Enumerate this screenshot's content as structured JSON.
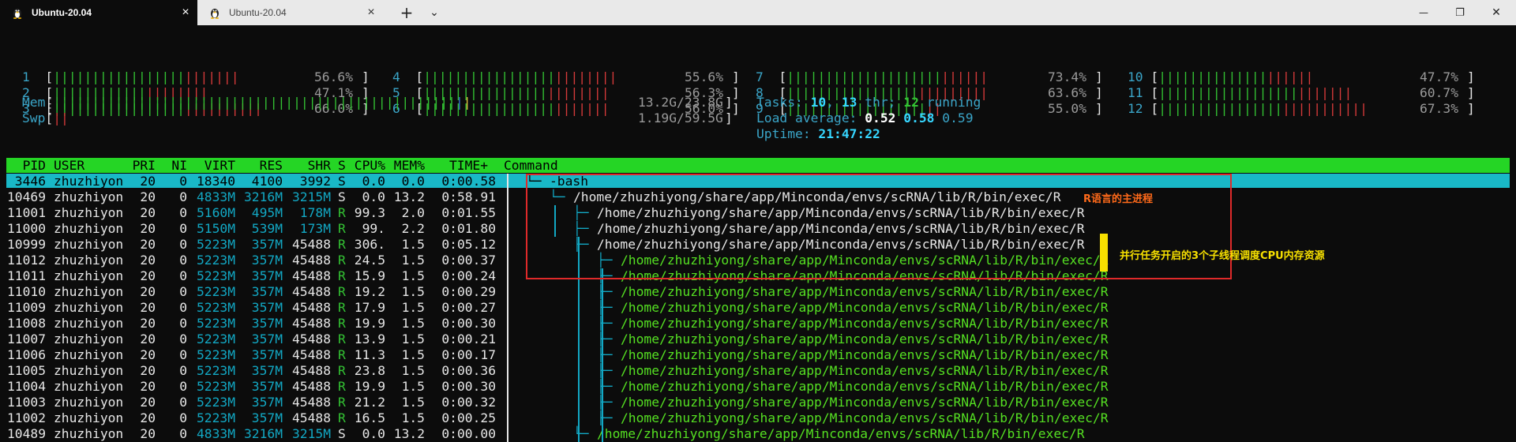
{
  "tabs": [
    {
      "title": "Ubuntu-20.04",
      "active": true
    },
    {
      "title": "Ubuntu-20.04",
      "active": false
    }
  ],
  "controls": {
    "close": "×",
    "new_tab": "+",
    "dropdown": "⌄",
    "min": "—",
    "max": "❐",
    "win_close": "✕"
  },
  "meters": [
    {
      "n": "1",
      "green": "|||||||||||||||||",
      "red": "|||||||",
      "pct": "56.6%"
    },
    {
      "n": "2",
      "green": "||||||||||||",
      "red": "||||||||",
      "pct": "47.1%"
    },
    {
      "n": "3",
      "green": "|||||||||||||||||",
      "red": "||||||||||",
      "pct": "66.0%"
    },
    {
      "n": "4",
      "green": "|||||||||||||||||",
      "red": "||||||||",
      "pct": "55.6%"
    },
    {
      "n": "5",
      "green": "||||||||||||||||",
      "red": "||||||||",
      "pct": "56.3%"
    },
    {
      "n": "6",
      "green": "|||||||||||||||||",
      "red": "|||||||",
      "pct": "56.0%"
    },
    {
      "n": "7",
      "green": "||||||||||||||||||||",
      "red": "||||||",
      "pct": "73.4%"
    },
    {
      "n": "8",
      "green": "|||||||||||||||||",
      "red": "|||||||||",
      "pct": "63.6%"
    },
    {
      "n": "9",
      "green": "||||||||||||||||||",
      "red": "||",
      "pct": "55.0%"
    },
    {
      "n": "10",
      "green": "||||||||||||||",
      "red": "||||||",
      "pct": "47.7%"
    },
    {
      "n": "11",
      "green": "||||||||||||||||||",
      "red": "|||||||",
      "pct": "60.7%"
    },
    {
      "n": "12",
      "green": "||||||||||||||||",
      "red": "|||||||||||",
      "pct": "67.3%"
    }
  ],
  "mem": {
    "label": "Mem",
    "bars": "||||||||||||||||||||||||||||||||||||||||||||||||||||",
    "value": "13.2G/23.8G"
  },
  "swp": {
    "label": "Swp",
    "bars": "||",
    "value": "1.19G/59.5G"
  },
  "tasks": {
    "label": "Tasks: ",
    "count": "10",
    "sep1": ", ",
    "thr": "13",
    "thr_label": " thr; ",
    "running": "12",
    "running_label": " running"
  },
  "load": {
    "label": "Load average: ",
    "v1": "0.52",
    "v2": "0.58",
    "v3": "0.59"
  },
  "uptime": {
    "label": "Uptime: ",
    "value": "21:47:22"
  },
  "columns": [
    "PID",
    "USER",
    "PRI",
    "NI",
    "VIRT",
    "RES",
    "SHR",
    "S",
    "CPU%",
    "MEM%",
    "TIME+",
    "Command"
  ],
  "processes": [
    {
      "pid": "3446",
      "user": "zhuzhiyon",
      "pri": "20",
      "ni": "0",
      "virt": "18340",
      "res": "4100",
      "shr": "3992",
      "s": "S",
      "cpu": "0.0",
      "mem": "0.0",
      "time": "0:00.58",
      "tree": "└─ ",
      "cmd": "-bash",
      "indent": 0,
      "sel": true
    },
    {
      "pid": "10469",
      "user": "zhuzhiyon",
      "pri": "20",
      "ni": "0",
      "virt": "4833M",
      "res": "3216M",
      "shr": "3215M",
      "s": "S",
      "cpu": "0.0",
      "mem": "13.2",
      "time": "0:58.91",
      "tree": "└─ ",
      "cmd": "/home/zhuzhiyong/share/app/Minconda/envs/scRNA/lib/R/bin/exec/R",
      "indent": 1
    },
    {
      "pid": "11001",
      "user": "zhuzhiyon",
      "pri": "20",
      "ni": "0",
      "virt": "5160M",
      "res": "495M",
      "shr": "178M",
      "s": "R",
      "cpu": "99.3",
      "mem": "2.0",
      "time": "0:01.55",
      "tree": "├─ ",
      "cmd": "/home/zhuzhiyong/share/app/Minconda/envs/scRNA/lib/R/bin/exec/R",
      "indent": 2
    },
    {
      "pid": "11000",
      "user": "zhuzhiyon",
      "pri": "20",
      "ni": "0",
      "virt": "5150M",
      "res": "539M",
      "shr": "173M",
      "s": "R",
      "cpu": "99.",
      "mem": "2.2",
      "time": "0:01.80",
      "tree": "├─ ",
      "cmd": "/home/zhuzhiyong/share/app/Minconda/envs/scRNA/lib/R/bin/exec/R",
      "indent": 2
    },
    {
      "pid": "10999",
      "user": "zhuzhiyon",
      "pri": "20",
      "ni": "0",
      "virt": "5223M",
      "res": "357M",
      "shr": "45488",
      "s": "R",
      "cpu": "306.",
      "mem": "1.5",
      "time": "0:05.12",
      "tree": "├─ ",
      "cmd": "/home/zhuzhiyong/share/app/Minconda/envs/scRNA/lib/R/bin/exec/R",
      "indent": 2
    },
    {
      "pid": "11012",
      "user": "zhuzhiyon",
      "pri": "20",
      "ni": "0",
      "virt": "5223M",
      "res": "357M",
      "shr": "45488",
      "s": "R",
      "cpu": "24.5",
      "mem": "1.5",
      "time": "0:00.37",
      "tree": "├─ ",
      "cmd": "/home/zhuzhiyong/share/app/Minconda/envs/scRNA/lib/R/bin/exec/R",
      "indent": 3
    },
    {
      "pid": "11011",
      "user": "zhuzhiyon",
      "pri": "20",
      "ni": "0",
      "virt": "5223M",
      "res": "357M",
      "shr": "45488",
      "s": "R",
      "cpu": "15.9",
      "mem": "1.5",
      "time": "0:00.24",
      "tree": "├─ ",
      "cmd": "/home/zhuzhiyong/share/app/Minconda/envs/scRNA/lib/R/bin/exec/R",
      "indent": 3
    },
    {
      "pid": "11010",
      "user": "zhuzhiyon",
      "pri": "20",
      "ni": "0",
      "virt": "5223M",
      "res": "357M",
      "shr": "45488",
      "s": "R",
      "cpu": "19.2",
      "mem": "1.5",
      "time": "0:00.29",
      "tree": "├─ ",
      "cmd": "/home/zhuzhiyong/share/app/Minconda/envs/scRNA/lib/R/bin/exec/R",
      "indent": 3
    },
    {
      "pid": "11009",
      "user": "zhuzhiyon",
      "pri": "20",
      "ni": "0",
      "virt": "5223M",
      "res": "357M",
      "shr": "45488",
      "s": "R",
      "cpu": "17.9",
      "mem": "1.5",
      "time": "0:00.27",
      "tree": "├─ ",
      "cmd": "/home/zhuzhiyong/share/app/Minconda/envs/scRNA/lib/R/bin/exec/R",
      "indent": 3
    },
    {
      "pid": "11008",
      "user": "zhuzhiyon",
      "pri": "20",
      "ni": "0",
      "virt": "5223M",
      "res": "357M",
      "shr": "45488",
      "s": "R",
      "cpu": "19.9",
      "mem": "1.5",
      "time": "0:00.30",
      "tree": "├─ ",
      "cmd": "/home/zhuzhiyong/share/app/Minconda/envs/scRNA/lib/R/bin/exec/R",
      "indent": 3
    },
    {
      "pid": "11007",
      "user": "zhuzhiyon",
      "pri": "20",
      "ni": "0",
      "virt": "5223M",
      "res": "357M",
      "shr": "45488",
      "s": "R",
      "cpu": "13.9",
      "mem": "1.5",
      "time": "0:00.21",
      "tree": "├─ ",
      "cmd": "/home/zhuzhiyong/share/app/Minconda/envs/scRNA/lib/R/bin/exec/R",
      "indent": 3
    },
    {
      "pid": "11006",
      "user": "zhuzhiyon",
      "pri": "20",
      "ni": "0",
      "virt": "5223M",
      "res": "357M",
      "shr": "45488",
      "s": "R",
      "cpu": "11.3",
      "mem": "1.5",
      "time": "0:00.17",
      "tree": "├─ ",
      "cmd": "/home/zhuzhiyong/share/app/Minconda/envs/scRNA/lib/R/bin/exec/R",
      "indent": 3
    },
    {
      "pid": "11005",
      "user": "zhuzhiyon",
      "pri": "20",
      "ni": "0",
      "virt": "5223M",
      "res": "357M",
      "shr": "45488",
      "s": "R",
      "cpu": "23.8",
      "mem": "1.5",
      "time": "0:00.36",
      "tree": "├─ ",
      "cmd": "/home/zhuzhiyong/share/app/Minconda/envs/scRNA/lib/R/bin/exec/R",
      "indent": 3
    },
    {
      "pid": "11004",
      "user": "zhuzhiyon",
      "pri": "20",
      "ni": "0",
      "virt": "5223M",
      "res": "357M",
      "shr": "45488",
      "s": "R",
      "cpu": "19.9",
      "mem": "1.5",
      "time": "0:00.30",
      "tree": "├─ ",
      "cmd": "/home/zhuzhiyong/share/app/Minconda/envs/scRNA/lib/R/bin/exec/R",
      "indent": 3
    },
    {
      "pid": "11003",
      "user": "zhuzhiyon",
      "pri": "20",
      "ni": "0",
      "virt": "5223M",
      "res": "357M",
      "shr": "45488",
      "s": "R",
      "cpu": "21.2",
      "mem": "1.5",
      "time": "0:00.32",
      "tree": "├─ ",
      "cmd": "/home/zhuzhiyong/share/app/Minconda/envs/scRNA/lib/R/bin/exec/R",
      "indent": 3
    },
    {
      "pid": "11002",
      "user": "zhuzhiyon",
      "pri": "20",
      "ni": "0",
      "virt": "5223M",
      "res": "357M",
      "shr": "45488",
      "s": "R",
      "cpu": "16.5",
      "mem": "1.5",
      "time": "0:00.25",
      "tree": "├─ ",
      "cmd": "/home/zhuzhiyong/share/app/Minconda/envs/scRNA/lib/R/bin/exec/R",
      "indent": 3
    },
    {
      "pid": "10489",
      "user": "zhuzhiyon",
      "pri": "20",
      "ni": "0",
      "virt": "4833M",
      "res": "3216M",
      "shr": "3215M",
      "s": "S",
      "cpu": "0.0",
      "mem": "13.2",
      "time": "0:00.00",
      "tree": "└─ ",
      "cmd": "/home/zhuzhiyong/share/app/Minconda/envs/scRNA/lib/R/bin/exec/R",
      "indent": 2
    }
  ],
  "annotations": {
    "main_process": "R语言的主进程",
    "sub_threads": "并行任务开启的3个子线程调度CPU内存资源"
  },
  "colors": {
    "header_bg": "#25d525",
    "selected_bg": "#19b8c7",
    "annotation_box": "#e02a2a",
    "annotation_main": "#ff6a1a",
    "annotation_sub": "#f7e000"
  }
}
